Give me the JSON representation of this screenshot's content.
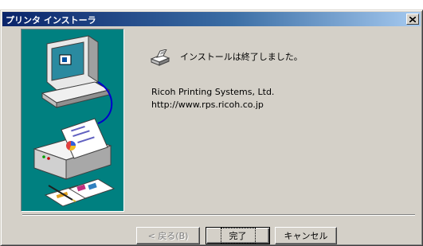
{
  "window": {
    "title": "プリンタ インストーラ",
    "close_label": "×"
  },
  "message": {
    "text": "インストールは終了しました。",
    "icon": "printer-setup-icon"
  },
  "info": {
    "company": "Ricoh Printing Systems, Ltd.",
    "url": "http://www.rps.ricoh.co.jp"
  },
  "buttons": {
    "back": "< 戻る(B)",
    "finish": "完了",
    "cancel": "キャンセル"
  },
  "illustration": {
    "icon": "computer-printer-illustration",
    "background": "#008080"
  },
  "colors": {
    "titlebar_start": "#0a246a",
    "titlebar_end": "#a6caf0",
    "dialog_face": "#d4d0c8"
  }
}
